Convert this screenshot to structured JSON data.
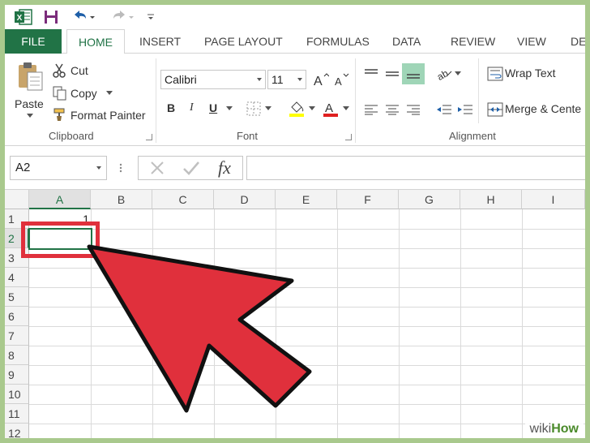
{
  "window": {
    "app": "Excel"
  },
  "colors": {
    "excel_green": "#217346",
    "highlight_red": "#e0303c",
    "frame_bg": "#a9c98d"
  },
  "qat": {
    "icons": [
      "excel-logo-icon",
      "save-icon",
      "undo-icon",
      "redo-icon",
      "customize-qat-icon"
    ]
  },
  "tabs": [
    "FILE",
    "HOME",
    "INSERT",
    "PAGE LAYOUT",
    "FORMULAS",
    "DATA",
    "REVIEW",
    "VIEW",
    "DE"
  ],
  "active_tab": "HOME",
  "ribbon": {
    "clipboard": {
      "paste": "Paste",
      "cut": "Cut",
      "copy": "Copy",
      "format_painter": "Format Painter",
      "label": "Clipboard"
    },
    "font": {
      "family": "Calibri",
      "size": "11",
      "bold": "B",
      "italic": "I",
      "underline": "U",
      "label": "Font"
    },
    "alignment": {
      "wrap_text": "Wrap Text",
      "merge_center": "Merge & Cente",
      "label": "Alignment"
    }
  },
  "formula_bar": {
    "name_box": "A2",
    "fx": "fx",
    "formula": ""
  },
  "grid": {
    "columns": [
      "A",
      "B",
      "C",
      "D",
      "E",
      "F",
      "G",
      "H",
      "I"
    ],
    "rows": [
      "1",
      "2",
      "3",
      "4",
      "5",
      "6",
      "7",
      "8",
      "9",
      "10",
      "11",
      "12"
    ],
    "selected_column": "A",
    "selected_row": "2",
    "cells": {
      "A1": "1"
    }
  },
  "watermark": {
    "part1": "wiki",
    "part2": "How"
  }
}
